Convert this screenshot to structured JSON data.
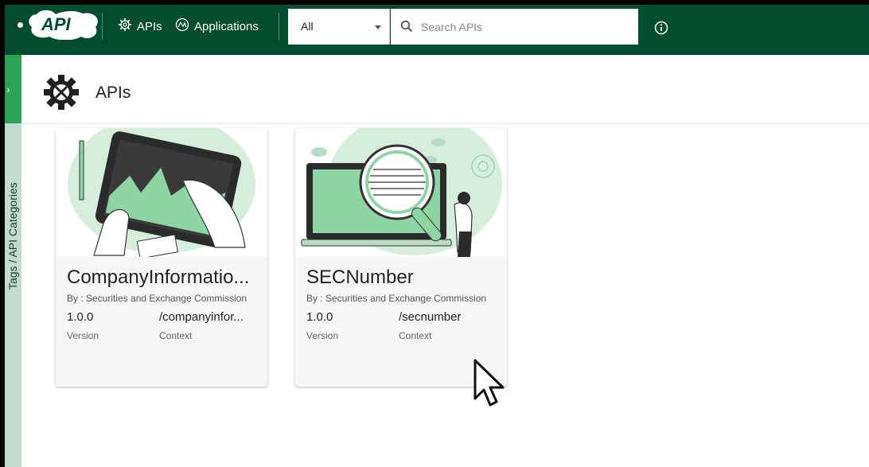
{
  "header": {
    "logo_text": "API",
    "nav": [
      {
        "label": "APIs",
        "icon": "gear-icon"
      },
      {
        "label": "Applications",
        "icon": "applications-icon"
      }
    ],
    "scope_select": {
      "value": "All"
    },
    "search": {
      "placeholder": "Search APIs",
      "value": ""
    }
  },
  "sidebar": {
    "label": "Tags / API Categories"
  },
  "page": {
    "title": "APIs"
  },
  "cards": [
    {
      "name": "CompanyInformatio...",
      "by": "By : Securities and Exchange Commission",
      "version": "1.0.0",
      "context": "/companyinfor...",
      "version_label": "Version",
      "context_label": "Context"
    },
    {
      "name": "SECNumber",
      "by": "By : Securities and Exchange Commission",
      "version": "1.0.0",
      "context": "/secnumber",
      "version_label": "Version",
      "context_label": "Context"
    }
  ],
  "colors": {
    "topbar": "#024d2f",
    "accent": "#2aa356",
    "rail": "#c4dccf",
    "illustration": "#8fd5a3"
  }
}
